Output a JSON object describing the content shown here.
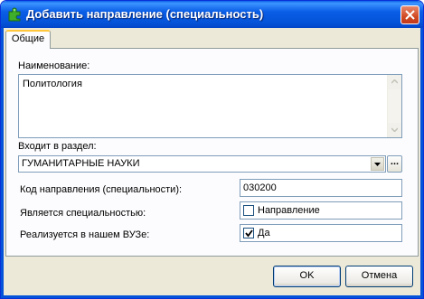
{
  "window": {
    "title": "Добавить направление (специальность)",
    "accent": "#0553d8",
    "title_icon": "green-puzzle-icon",
    "close_icon": "close-icon"
  },
  "tabs": [
    {
      "label": "Общие",
      "active": true
    }
  ],
  "form": {
    "name_label": "Наименование:",
    "name_value": "Политология",
    "section_label": "Входит в раздел:",
    "section_value": "ГУМАНИТАРНЫЕ НАУКИ",
    "section_dots": "...",
    "code_label": "Код направления (специальности):",
    "code_value": "030200",
    "is_specialty_label": "Является специальностью:",
    "is_specialty_checkbox_label": "Направление",
    "is_specialty_checked": false,
    "implemented_label": "Реализуется в нашем ВУЗе:",
    "implemented_checkbox_label": "Да",
    "implemented_checked": true
  },
  "buttons": {
    "ok": "OK",
    "cancel": "Отмена"
  }
}
